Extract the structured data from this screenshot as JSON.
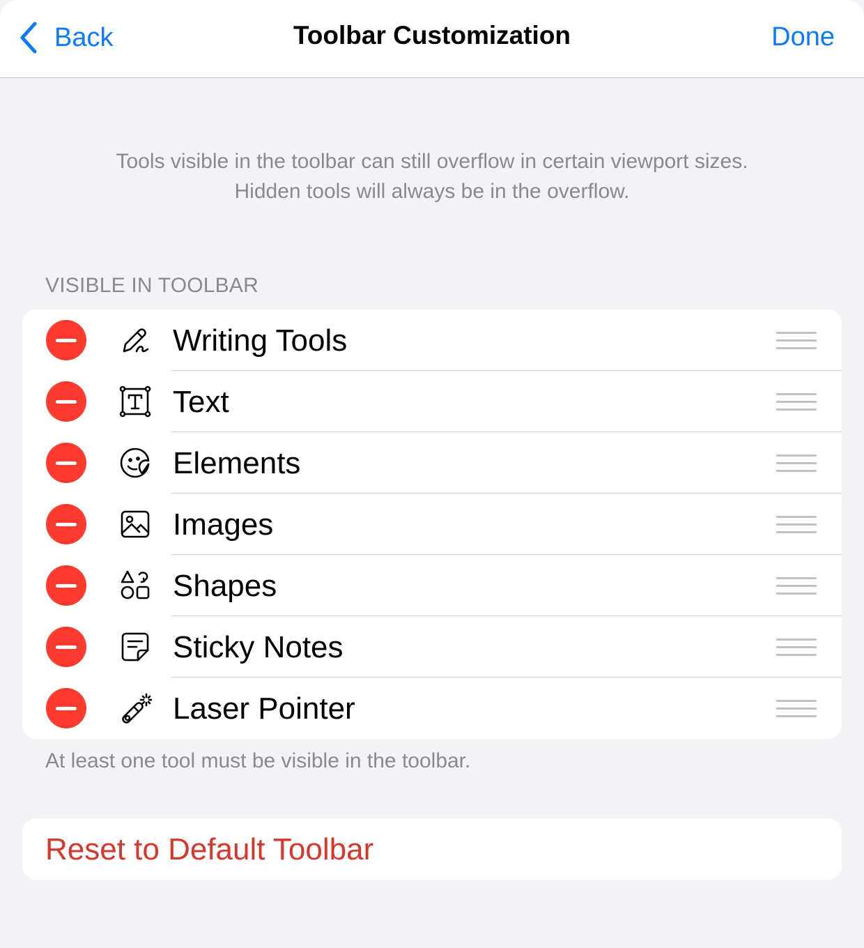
{
  "navbar": {
    "back_label": "Back",
    "title": "Toolbar Customization",
    "done_label": "Done"
  },
  "info_line1": "Tools visible in the toolbar can still overflow in certain viewport sizes.",
  "info_line2": "Hidden tools will always be in the overflow.",
  "section_header": "VISIBLE IN TOOLBAR",
  "tools": [
    {
      "label": "Writing Tools",
      "icon": "pen-icon"
    },
    {
      "label": "Text",
      "icon": "text-box-icon"
    },
    {
      "label": "Elements",
      "icon": "sticker-icon"
    },
    {
      "label": "Images",
      "icon": "image-icon"
    },
    {
      "label": "Shapes",
      "icon": "shapes-icon"
    },
    {
      "label": "Sticky Notes",
      "icon": "sticky-note-icon"
    },
    {
      "label": "Laser Pointer",
      "icon": "laser-pointer-icon"
    }
  ],
  "footer_note": "At least one tool must be visible in the toolbar.",
  "reset_label": "Reset to Default Toolbar",
  "colors": {
    "accent": "#0a7aff",
    "destructive": "#ff3b30",
    "reset_text": "#d7372b",
    "background": "#f2f2f7"
  }
}
